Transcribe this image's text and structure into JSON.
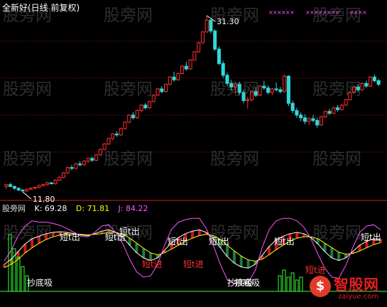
{
  "header": {
    "title": "全新好(日线 前复权)"
  },
  "indicator": {
    "source": "股旁网",
    "k_label": "K: 69.28",
    "d_label": "D: 71.81",
    "j_label": "J: 84.22",
    "k_color": "#ffffff",
    "d_color": "#ffff00",
    "j_color": "#ff44ff"
  },
  "watermark": "股旁网",
  "logo": {
    "text": "智股网",
    "url": "zaiyue.com"
  },
  "chart_data": [
    {
      "type": "candlestick",
      "title": "全新好(日线 前复权)",
      "annotations": [
        {
          "label": "31.30",
          "kind": "high",
          "value": 31.3
        },
        {
          "label": "11.80",
          "kind": "low",
          "value": 11.8
        }
      ],
      "ohlc_series": [
        [
          12.4,
          12.7,
          12.1,
          12.6
        ],
        [
          12.6,
          12.8,
          12.3,
          12.4
        ],
        [
          12.4,
          12.5,
          12.0,
          12.2
        ],
        [
          12.2,
          12.3,
          11.9,
          12.0
        ],
        [
          12.0,
          12.1,
          11.8,
          11.9
        ],
        [
          11.9,
          12.2,
          11.8,
          12.1
        ],
        [
          12.1,
          12.3,
          12.0,
          12.2
        ],
        [
          12.2,
          12.4,
          12.1,
          12.3
        ],
        [
          12.3,
          12.6,
          12.2,
          12.5
        ],
        [
          12.5,
          12.7,
          12.4,
          12.6
        ],
        [
          12.6,
          12.9,
          12.5,
          12.8
        ],
        [
          12.8,
          12.9,
          12.6,
          12.7
        ],
        [
          12.7,
          13.2,
          12.6,
          13.1
        ],
        [
          13.1,
          13.5,
          13.0,
          13.4
        ],
        [
          13.4,
          14.0,
          13.3,
          13.9
        ],
        [
          13.9,
          14.6,
          13.8,
          14.5
        ],
        [
          14.5,
          14.8,
          14.2,
          14.4
        ],
        [
          14.4,
          15.0,
          14.3,
          14.9
        ],
        [
          14.9,
          15.2,
          14.6,
          14.8
        ],
        [
          14.8,
          15.3,
          14.7,
          15.2
        ],
        [
          15.2,
          15.6,
          15.0,
          15.5
        ],
        [
          15.5,
          15.7,
          15.1,
          15.3
        ],
        [
          15.3,
          16.0,
          15.2,
          15.9
        ],
        [
          15.9,
          16.6,
          15.8,
          16.5
        ],
        [
          16.5,
          17.2,
          16.4,
          17.1
        ],
        [
          17.1,
          17.8,
          17.0,
          17.7
        ],
        [
          17.7,
          18.3,
          17.5,
          18.2
        ],
        [
          18.2,
          18.5,
          17.9,
          18.1
        ],
        [
          18.1,
          18.9,
          18.0,
          18.8
        ],
        [
          18.8,
          19.6,
          18.7,
          19.5
        ],
        [
          19.5,
          20.4,
          19.4,
          20.3
        ],
        [
          20.3,
          20.6,
          19.8,
          20.0
        ],
        [
          20.0,
          20.9,
          19.9,
          20.8
        ],
        [
          20.8,
          21.5,
          20.6,
          21.4
        ],
        [
          21.4,
          21.6,
          20.9,
          21.1
        ],
        [
          21.1,
          21.9,
          21.0,
          21.8
        ],
        [
          21.8,
          22.6,
          21.7,
          22.5
        ],
        [
          22.5,
          23.3,
          22.4,
          23.2
        ],
        [
          23.2,
          23.5,
          22.7,
          22.9
        ],
        [
          22.9,
          23.8,
          22.8,
          23.7
        ],
        [
          23.7,
          24.6,
          23.6,
          24.5
        ],
        [
          24.5,
          25.1,
          24.0,
          24.2
        ],
        [
          24.2,
          25.0,
          24.1,
          24.9
        ],
        [
          24.9,
          25.8,
          24.8,
          25.7
        ],
        [
          25.7,
          26.2,
          25.2,
          25.4
        ],
        [
          25.4,
          26.5,
          25.3,
          26.4
        ],
        [
          26.4,
          27.4,
          26.3,
          27.3
        ],
        [
          27.3,
          28.4,
          27.2,
          28.3
        ],
        [
          28.3,
          29.6,
          28.2,
          29.5
        ],
        [
          29.5,
          31.3,
          29.4,
          30.8
        ],
        [
          30.8,
          31.0,
          29.3,
          29.6
        ],
        [
          29.6,
          29.8,
          27.4,
          27.6
        ],
        [
          27.6,
          27.9,
          25.8,
          26.0
        ],
        [
          26.0,
          26.3,
          24.4,
          24.7
        ],
        [
          24.7,
          25.0,
          23.5,
          23.8
        ],
        [
          23.8,
          24.2,
          23.0,
          23.4
        ],
        [
          23.4,
          23.9,
          22.6,
          23.7
        ],
        [
          23.7,
          24.0,
          22.5,
          22.8
        ],
        [
          22.8,
          23.1,
          21.6,
          21.9
        ],
        [
          21.9,
          22.3,
          21.0,
          22.0
        ],
        [
          22.0,
          23.0,
          21.8,
          22.9
        ],
        [
          22.9,
          23.4,
          22.3,
          22.5
        ],
        [
          22.5,
          23.6,
          22.4,
          23.5
        ],
        [
          23.5,
          24.1,
          23.1,
          23.3
        ],
        [
          23.3,
          23.6,
          22.6,
          22.8
        ],
        [
          22.8,
          23.3,
          22.5,
          23.2
        ],
        [
          23.2,
          23.9,
          22.9,
          23.1
        ],
        [
          23.1,
          23.4,
          22.7,
          22.9
        ],
        [
          22.9,
          24.8,
          22.8,
          24.6
        ],
        [
          24.6,
          24.7,
          21.3,
          21.6
        ],
        [
          21.6,
          21.9,
          20.5,
          20.8
        ],
        [
          20.8,
          21.1,
          20.0,
          20.3
        ],
        [
          20.3,
          20.6,
          19.6,
          20.0
        ],
        [
          20.0,
          20.4,
          19.3,
          19.6
        ],
        [
          19.6,
          20.1,
          19.2,
          19.9
        ],
        [
          19.9,
          20.3,
          19.5,
          19.7
        ],
        [
          19.7,
          20.0,
          18.9,
          19.2
        ],
        [
          19.2,
          20.2,
          19.1,
          20.1
        ],
        [
          20.1,
          20.8,
          20.0,
          20.7
        ],
        [
          20.7,
          21.0,
          20.3,
          20.5
        ],
        [
          20.5,
          21.2,
          20.4,
          21.1
        ],
        [
          21.1,
          21.4,
          20.7,
          20.9
        ],
        [
          20.9,
          21.5,
          20.8,
          21.4
        ],
        [
          21.4,
          22.1,
          21.3,
          22.0
        ],
        [
          22.0,
          22.9,
          21.9,
          22.8
        ],
        [
          22.8,
          23.5,
          22.7,
          23.4
        ],
        [
          23.4,
          23.7,
          22.9,
          23.1
        ],
        [
          23.1,
          23.9,
          23.0,
          23.8
        ],
        [
          23.8,
          24.1,
          23.3,
          23.5
        ],
        [
          23.5,
          24.6,
          23.4,
          24.5
        ],
        [
          24.5,
          24.8,
          23.9,
          24.1
        ],
        [
          24.1,
          24.3,
          23.5,
          23.7
        ]
      ]
    },
    {
      "type": "line",
      "title": "KDJ",
      "series": [
        {
          "name": "K",
          "values": [
            30,
            38,
            50,
            62,
            70,
            74,
            78,
            80,
            81,
            80,
            78,
            76,
            75,
            78,
            82,
            84,
            80,
            72,
            60,
            48,
            40,
            36,
            40,
            52,
            64,
            72,
            78,
            82,
            84,
            80,
            70,
            56,
            42,
            32,
            26,
            24,
            30,
            44,
            58,
            68,
            74,
            78,
            80,
            78,
            72,
            62,
            50,
            40,
            36,
            40,
            50,
            60,
            66,
            70,
            69
          ]
        },
        {
          "name": "D",
          "values": [
            25,
            30,
            38,
            48,
            56,
            63,
            69,
            73,
            76,
            77,
            77,
            77,
            76,
            77,
            78,
            80,
            80,
            77,
            71,
            63,
            55,
            48,
            45,
            48,
            54,
            60,
            66,
            71,
            75,
            77,
            75,
            69,
            60,
            51,
            43,
            37,
            35,
            38,
            45,
            53,
            60,
            66,
            71,
            73,
            73,
            70,
            63,
            56,
            49,
            46,
            47,
            51,
            56,
            61,
            64
          ]
        },
        {
          "name": "J",
          "values": [
            35,
            52,
            75,
            90,
            98,
            96,
            96,
            94,
            91,
            86,
            80,
            74,
            73,
            80,
            90,
            92,
            80,
            62,
            38,
            18,
            10,
            12,
            30,
            60,
            85,
            96,
            100,
            102,
            102,
            86,
            60,
            30,
            6,
            0,
            0,
            2,
            20,
            56,
            84,
            98,
            102,
            102,
            98,
            88,
            70,
            46,
            24,
            10,
            8,
            28,
            56,
            80,
            90,
            92,
            84
          ]
        }
      ],
      "signal_labels": [
        "短t出",
        "短t出",
        "短t出",
        "短t出",
        "短t出",
        "短t出",
        "短t出",
        "短t进",
        "短t进",
        "短t进",
        "抄底吸",
        "抄底吸",
        "抄底吸"
      ]
    }
  ]
}
